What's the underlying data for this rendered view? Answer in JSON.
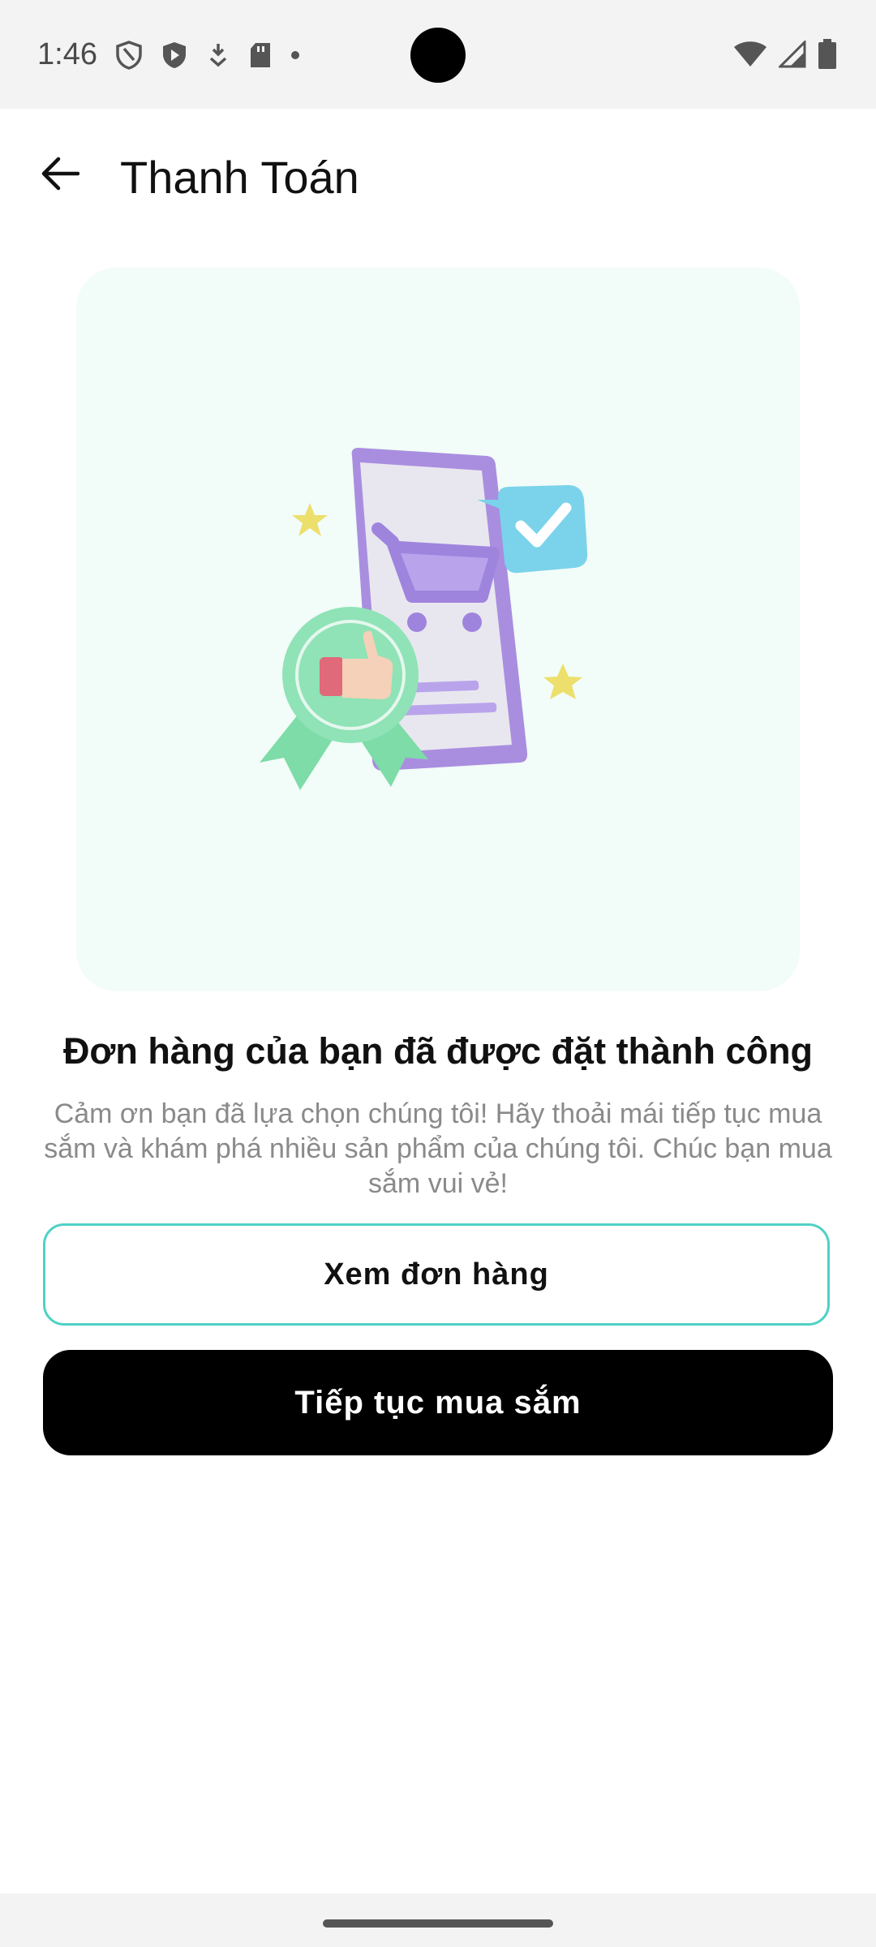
{
  "status_bar": {
    "time": "1:46"
  },
  "app_bar": {
    "title": "Thanh Toán"
  },
  "confirmation": {
    "headline": "Đơn hàng của bạn đã được đặt thành công",
    "description": "Cảm ơn bạn đã lựa chọn chúng tôi! Hãy thoải mái tiếp tục mua sắm và khám phá nhiều sản phẩm của chúng tôi. Chúc bạn mua sắm vui vẻ!"
  },
  "actions": {
    "view_order_label": "Xem đơn hàng",
    "continue_shopping_label": "Tiếp tục mua sắm"
  },
  "colors": {
    "accent_outline": "#4fd1c5",
    "primary_button": "#000000",
    "illustration_bg": "#f2fcf8"
  }
}
